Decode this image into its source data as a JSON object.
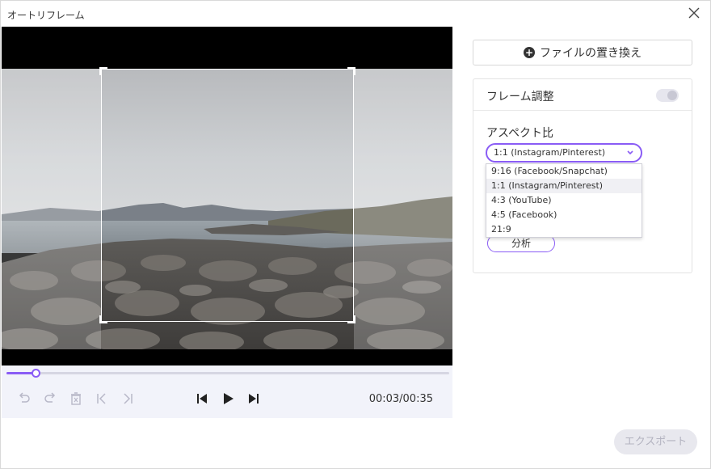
{
  "window": {
    "title": "オートリフレーム"
  },
  "player": {
    "progress": 0.065,
    "time": "00:03/00:35",
    "crop_aspect": "1:1"
  },
  "replace_button": {
    "label": "ファイルの置き換え",
    "icon": "plus-circle-icon"
  },
  "frame_panel": {
    "title": "フレーム調整",
    "toggle_on": false,
    "aspect_label": "アスペクト比",
    "selected": "1:1 (Instagram/Pinterest)",
    "options": [
      "9:16 (Facebook/Snapchat)",
      "1:1 (Instagram/Pinterest)",
      "4:3 (YouTube)",
      "4:5 (Facebook)",
      "21:9"
    ],
    "analyze_label": "分析"
  },
  "export_button": {
    "label": "エクスポート"
  },
  "colors": {
    "accent": "#8a5cf5",
    "disabled": "#b3b3c0"
  }
}
